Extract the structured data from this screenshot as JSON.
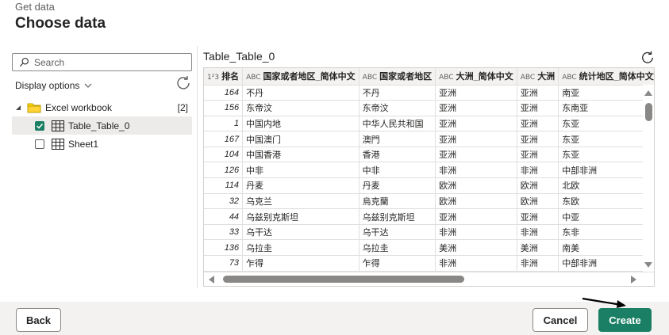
{
  "header": {
    "subtitle": "Get data",
    "title": "Choose data"
  },
  "left": {
    "search_placeholder": "Search",
    "display_options": "Display options",
    "tree": {
      "workbook_label": "Excel workbook",
      "workbook_count": "[2]",
      "items": [
        {
          "label": "Table_Table_0",
          "checked": true
        },
        {
          "label": "Sheet1",
          "checked": false
        }
      ]
    }
  },
  "preview": {
    "title": "Table_Table_0",
    "columns": [
      {
        "type_icon": "1²3",
        "label": "排名"
      },
      {
        "type_icon": "ABC",
        "label": "国家或者地区_简体中文"
      },
      {
        "type_icon": "ABC",
        "label": "国家或者地区"
      },
      {
        "type_icon": "ABC",
        "label": "大洲_简体中文"
      },
      {
        "type_icon": "ABC",
        "label": "大洲"
      },
      {
        "type_icon": "ABC",
        "label": "统计地区_简体中文"
      },
      {
        "type_icon": "ABC",
        "label": ""
      }
    ],
    "rows": [
      [
        "164",
        "不丹",
        "不丹",
        "亚洲",
        "亚洲",
        "南亚",
        ""
      ],
      [
        "156",
        "东帝汶",
        "东帝汶",
        "亚洲",
        "亚洲",
        "东南亚",
        ""
      ],
      [
        "1",
        "中国内地",
        "中华人民共和国",
        "亚洲",
        "亚洲",
        "东亚",
        ""
      ],
      [
        "167",
        "中国澳门",
        "澳門",
        "亚洲",
        "亚洲",
        "东亚",
        ""
      ],
      [
        "104",
        "中国香港",
        "香港",
        "亚洲",
        "亚洲",
        "东亚",
        ""
      ],
      [
        "126",
        "中非",
        "中非",
        "非洲",
        "非洲",
        "中部非洲",
        ""
      ],
      [
        "114",
        "丹麦",
        "丹麦",
        "欧洲",
        "欧洲",
        "北欧",
        ""
      ],
      [
        "32",
        "乌克兰",
        "烏克蘭",
        "欧洲",
        "欧洲",
        "东欧",
        ""
      ],
      [
        "44",
        "乌兹别克斯坦",
        "乌兹别克斯坦",
        "亚洲",
        "亚洲",
        "中亚",
        ""
      ],
      [
        "33",
        "乌干达",
        "乌干达",
        "非洲",
        "非洲",
        "东非",
        ""
      ],
      [
        "136",
        "乌拉圭",
        "乌拉圭",
        "美洲",
        "美洲",
        "南美",
        ""
      ],
      [
        "73",
        "乍得",
        "乍得",
        "非洲",
        "非洲",
        "中部非洲",
        ""
      ]
    ]
  },
  "footer": {
    "back_label": "Back",
    "cancel_label": "Cancel",
    "create_label": "Create"
  },
  "colors": {
    "accent": "#1a7f64",
    "header_bg": "#f3f2f1",
    "selected_row": "#edebe9"
  }
}
